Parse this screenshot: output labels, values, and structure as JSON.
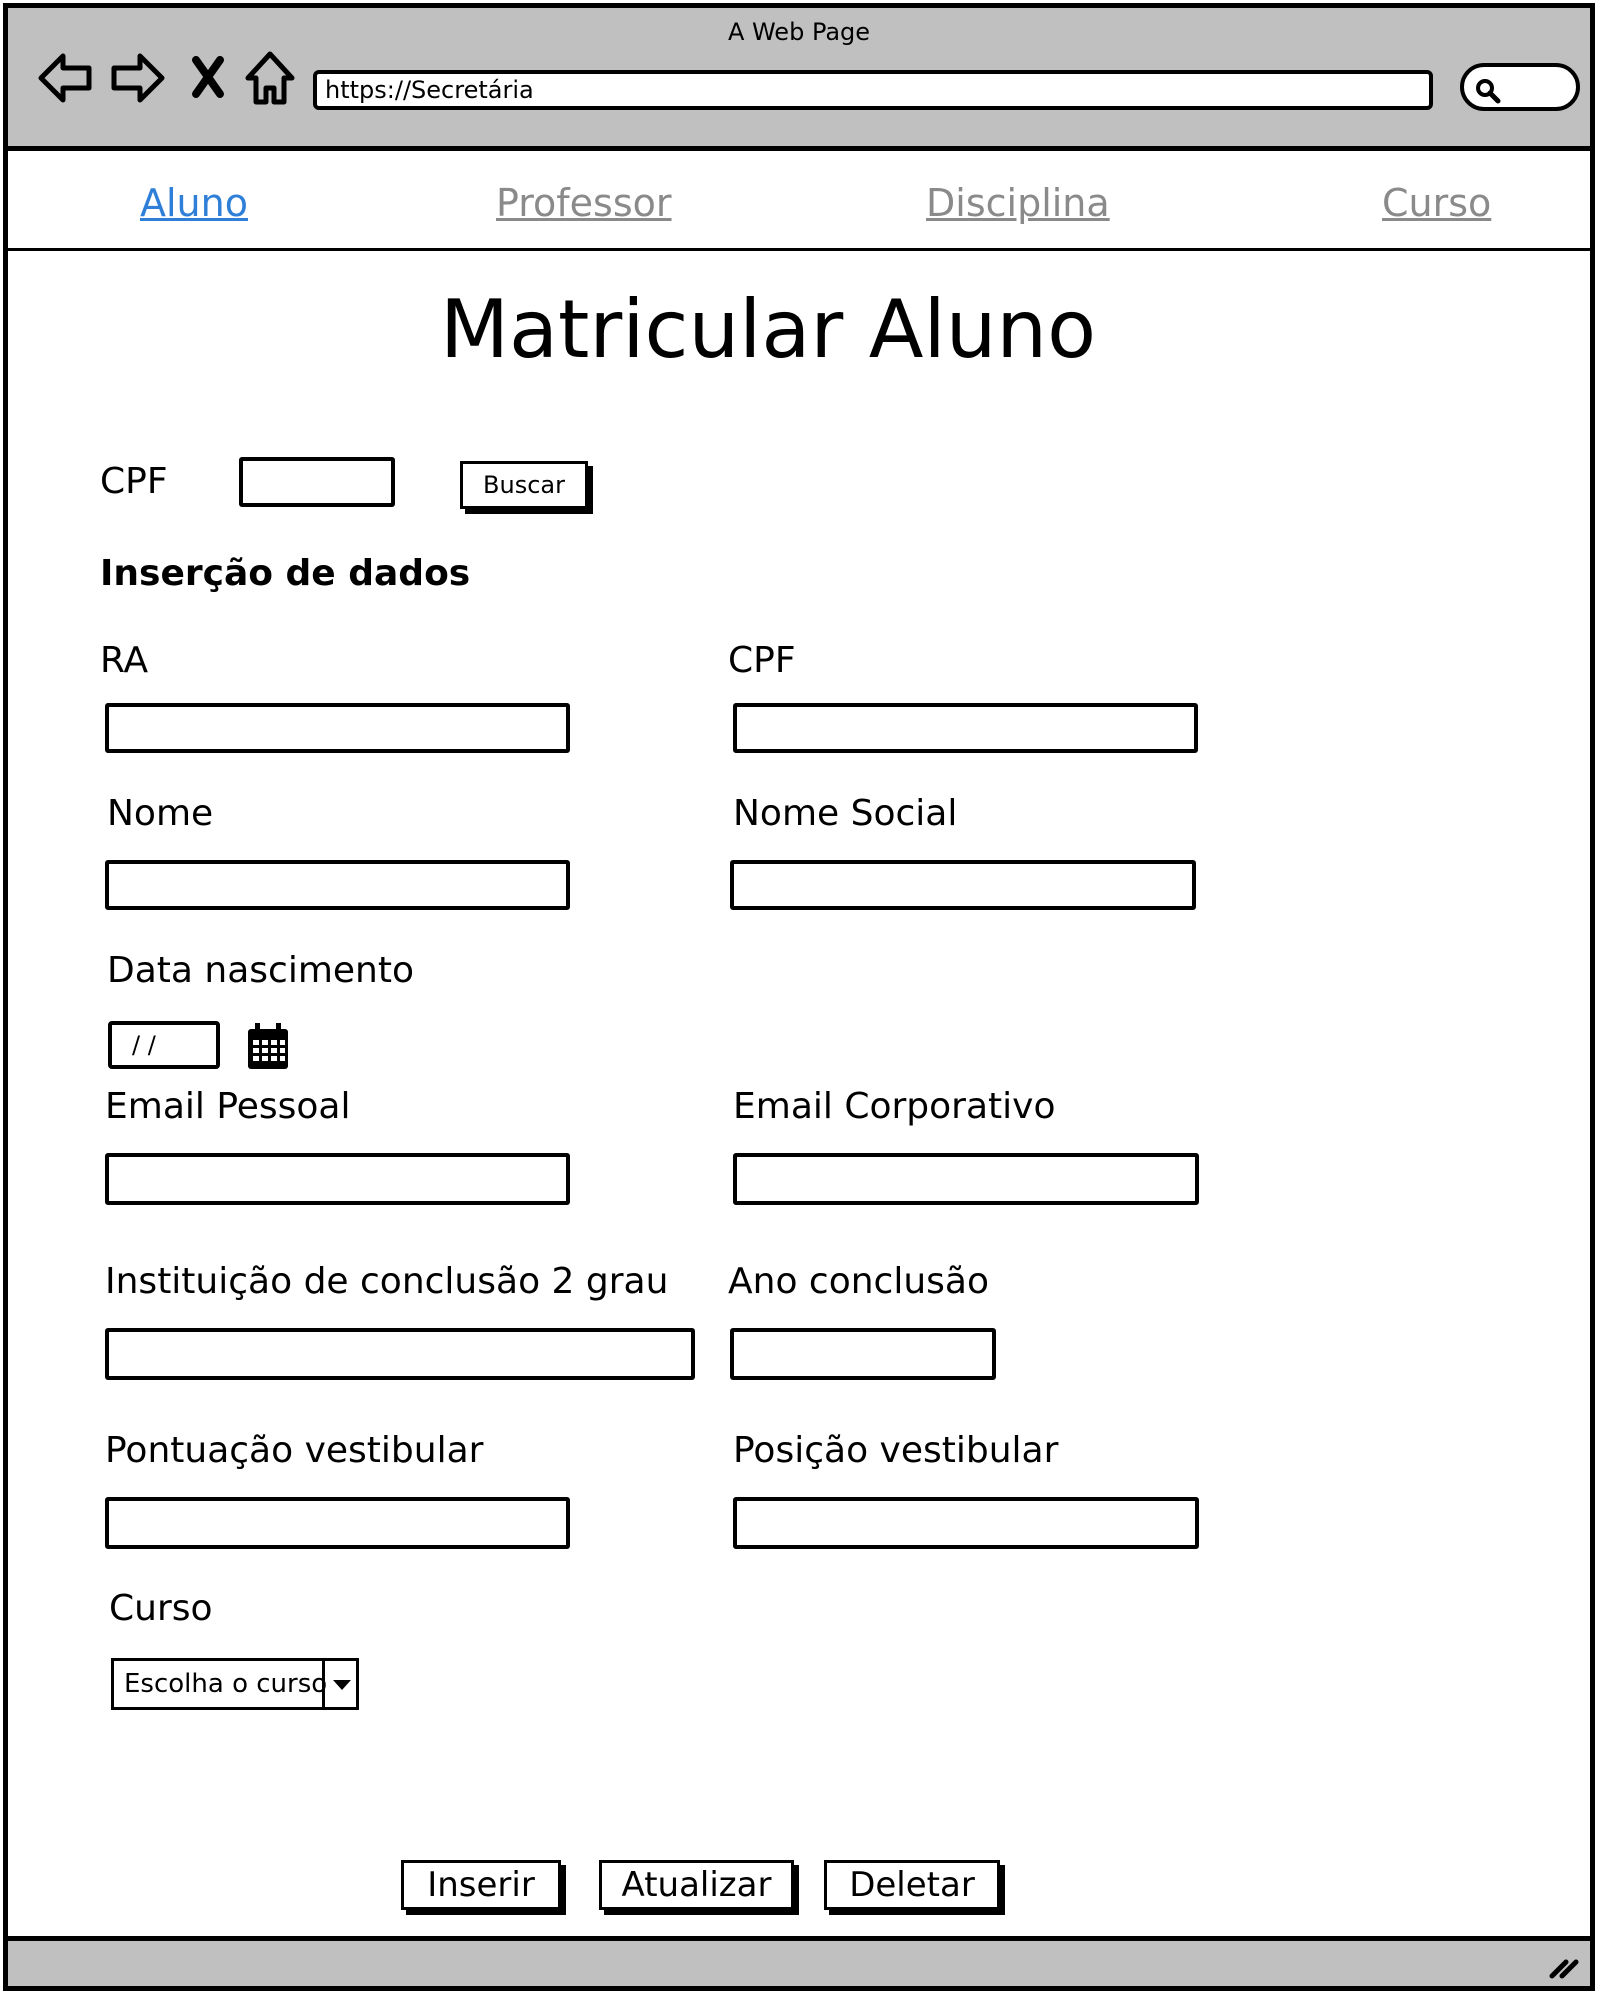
{
  "window": {
    "title": "A Web Page"
  },
  "browser": {
    "url": "https://Secretária"
  },
  "nav": {
    "tabs": [
      {
        "label": "Aluno",
        "active": true
      },
      {
        "label": "Professor",
        "active": false
      },
      {
        "label": "Disciplina",
        "active": false
      },
      {
        "label": "Curso",
        "active": false
      }
    ]
  },
  "page": {
    "title": "Matricular Aluno"
  },
  "search": {
    "cpf_label": "CPF",
    "cpf_value": "",
    "button": "Buscar"
  },
  "form": {
    "section_title": "Inserção de dados",
    "ra": {
      "label": "RA",
      "value": ""
    },
    "cpf": {
      "label": "CPF",
      "value": ""
    },
    "nome": {
      "label": "Nome",
      "value": ""
    },
    "nome_social": {
      "label": "Nome Social",
      "value": ""
    },
    "data_nascimento": {
      "label": "Data nascimento",
      "value": "/ /"
    },
    "email_pessoal": {
      "label": "Email Pessoal",
      "value": ""
    },
    "email_corporativo": {
      "label": "Email Corporativo",
      "value": ""
    },
    "instituicao": {
      "label": "Instituição de conclusão 2 grau",
      "value": ""
    },
    "ano_conclusao": {
      "label": "Ano conclusão",
      "value": ""
    },
    "pontuacao": {
      "label": "Pontuação vestibular",
      "value": ""
    },
    "posicao": {
      "label": "Posição vestibular",
      "value": ""
    },
    "curso": {
      "label": "Curso",
      "selected": "Escolha o curso"
    }
  },
  "actions": {
    "inserir": "Inserir",
    "atualizar": "Atualizar",
    "deletar": "Deletar"
  }
}
